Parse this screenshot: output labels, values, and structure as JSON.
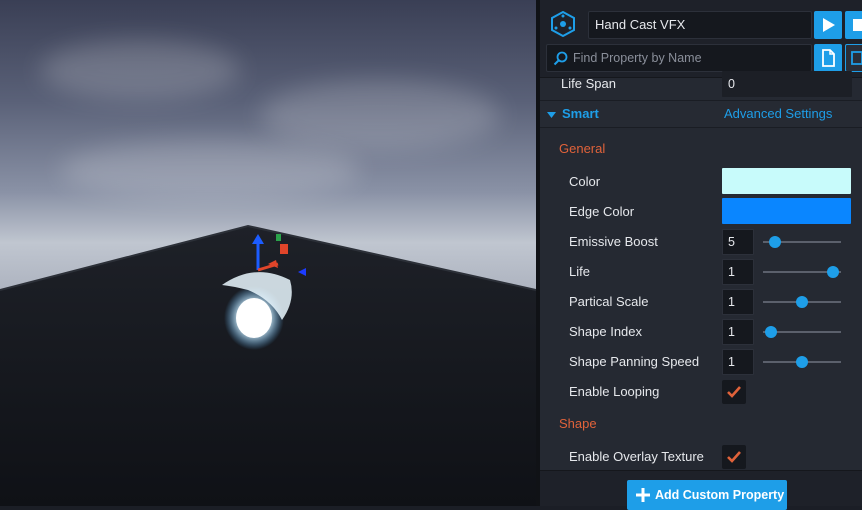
{
  "header": {
    "object_name": "Hand Cast VFX",
    "search_placeholder": "Find Property by Name"
  },
  "properties": {
    "life_span": {
      "label": "Life Span",
      "value": "0"
    },
    "smart_section": {
      "title": "Smart",
      "advanced_link": "Advanced Settings"
    },
    "groups": {
      "general": "General",
      "shape": "Shape"
    },
    "color": {
      "label": "Color",
      "value": "#c8fbfb"
    },
    "edge_color": {
      "label": "Edge Color",
      "value": "#0a86ff"
    },
    "emissive_boost": {
      "label": "Emissive Boost",
      "value": "5",
      "slider_fraction": 0.16
    },
    "life": {
      "label": "Life",
      "value": "1",
      "slider_fraction": 0.9
    },
    "partical_scale": {
      "label": "Partical Scale",
      "value": "1",
      "slider_fraction": 0.5
    },
    "shape_index": {
      "label": "Shape Index",
      "value": "1",
      "slider_fraction": 0.1
    },
    "shape_panning_speed": {
      "label": "Shape Panning Speed",
      "value": "1",
      "slider_fraction": 0.5
    },
    "enable_looping": {
      "label": "Enable Looping",
      "checked": true
    },
    "enable_overlay_texture": {
      "label": "Enable Overlay Texture",
      "checked": true
    }
  },
  "footer": {
    "add_button": "Add Custom Property"
  },
  "colors": {
    "accent": "#1e9ee8",
    "group_header": "#e0623a",
    "checkmark": "#e0623a"
  }
}
